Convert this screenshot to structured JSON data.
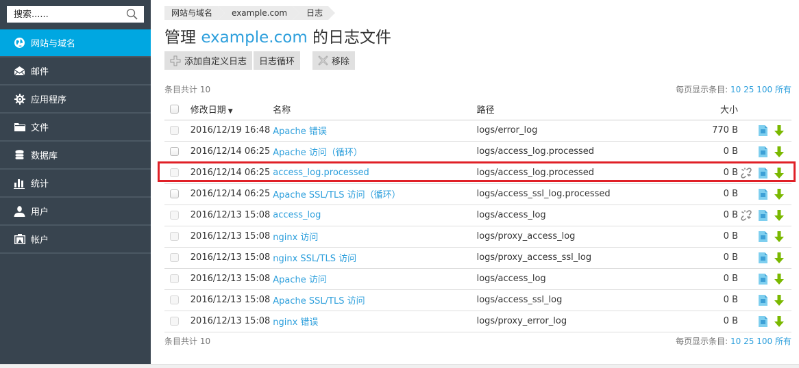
{
  "sidebar": {
    "search": {
      "placeholder": "搜索......",
      "value": ""
    },
    "items": [
      {
        "label": "网站与域名",
        "icon": "globe-icon",
        "active": true
      },
      {
        "label": "邮件",
        "icon": "envelope-icon",
        "active": false
      },
      {
        "label": "应用程序",
        "icon": "gear-icon",
        "active": false
      },
      {
        "label": "文件",
        "icon": "folder-icon",
        "active": false
      },
      {
        "label": "数据库",
        "icon": "database-icon",
        "active": false
      },
      {
        "label": "统计",
        "icon": "bar-chart-icon",
        "active": false
      },
      {
        "label": "用户",
        "icon": "user-icon",
        "active": false
      },
      {
        "label": "帐户",
        "icon": "account-icon",
        "active": false
      }
    ]
  },
  "breadcrumb": [
    "网站与域名",
    "example.com",
    "日志"
  ],
  "title": {
    "prefix": "管理 ",
    "domain": "example.com",
    "suffix": " 的日志文件"
  },
  "toolbar": {
    "add_label": "添加自定义日志",
    "rotate_label": "日志循环",
    "remove_label": "移除"
  },
  "summary": {
    "label": "条目共计",
    "count": "10"
  },
  "pager": {
    "label": "每页显示条目:",
    "options": [
      "10",
      "25",
      "100",
      "所有"
    ]
  },
  "table": {
    "headers": {
      "date": "修改日期",
      "name": "名称",
      "path": "路径",
      "size": "大小"
    },
    "rows": [
      {
        "date": "2016/12/19 16:48",
        "name": "Apache 错误",
        "path": "logs/error_log",
        "size": "770 B",
        "link": false,
        "checkbox_enabled": false
      },
      {
        "date": "2016/12/14 06:25",
        "name": "Apache 访问（循环）",
        "path": "logs/access_log.processed",
        "size": "0 B",
        "link": false,
        "checkbox_enabled": true
      },
      {
        "date": "2016/12/14 06:25",
        "name": "access_log.processed",
        "path": "logs/access_log.processed",
        "size": "0 B",
        "link": true,
        "checkbox_enabled": false,
        "highlighted": true
      },
      {
        "date": "2016/12/14 06:25",
        "name": "Apache SSL/TLS 访问（循环）",
        "path": "logs/access_ssl_log.processed",
        "size": "0 B",
        "link": false,
        "checkbox_enabled": true
      },
      {
        "date": "2016/12/13 15:08",
        "name": "access_log",
        "path": "logs/access_log",
        "size": "0 B",
        "link": true,
        "checkbox_enabled": false
      },
      {
        "date": "2016/12/13 15:08",
        "name": "nginx 访问",
        "path": "logs/proxy_access_log",
        "size": "0 B",
        "link": false,
        "checkbox_enabled": false
      },
      {
        "date": "2016/12/13 15:08",
        "name": "nginx SSL/TLS 访问",
        "path": "logs/proxy_access_ssl_log",
        "size": "0 B",
        "link": false,
        "checkbox_enabled": false
      },
      {
        "date": "2016/12/13 15:08",
        "name": "Apache 访问",
        "path": "logs/access_log",
        "size": "0 B",
        "link": false,
        "checkbox_enabled": false
      },
      {
        "date": "2016/12/13 15:08",
        "name": "Apache SSL/TLS 访问",
        "path": "logs/access_ssl_log",
        "size": "0 B",
        "link": false,
        "checkbox_enabled": false
      },
      {
        "date": "2016/12/13 15:08",
        "name": "nginx 错误",
        "path": "logs/proxy_error_log",
        "size": "0 B",
        "link": false,
        "checkbox_enabled": false
      }
    ]
  },
  "colors": {
    "sidebar_bg": "#38444f",
    "active_nav": "#00a7e1",
    "link": "#2d9fdc",
    "highlight": "#e02027",
    "download": "#7ab800",
    "file": "#7fcfef"
  }
}
